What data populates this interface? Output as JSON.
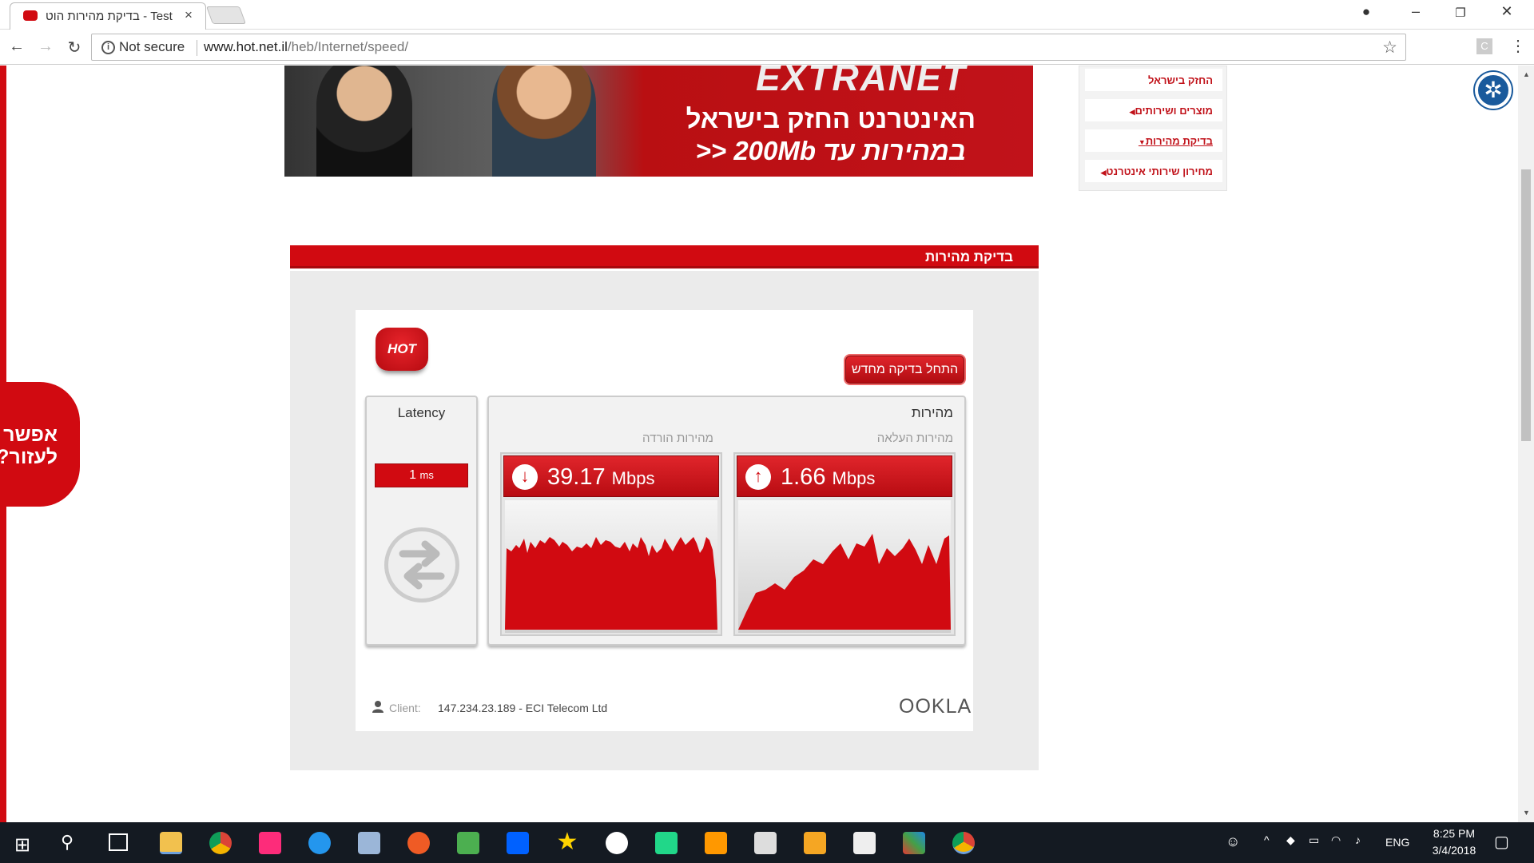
{
  "browser": {
    "tab_title": "בדיקת מהירות הוט - Test",
    "tab_close": "×",
    "not_secure": "Not secure",
    "url_host": "www.hot.net.il",
    "url_path": "/heb/Internet/speed/",
    "ext_letter": "C"
  },
  "banner": {
    "brand": "EXTRANET",
    "line1": "האינטרנט החזק בישראל",
    "line2": "במהירות עד 200Mb <<"
  },
  "sidebar": {
    "items": [
      {
        "label": "החזק בישראל"
      },
      {
        "label": "מוצרים ושירותים"
      },
      {
        "label": "בדיקת מהירות"
      },
      {
        "label": "מחירון שירותי אינטרנט"
      }
    ]
  },
  "help": {
    "label": "אפשר לעזור?"
  },
  "speedtest": {
    "section_title": "בדיקת מהירות",
    "logo": "HOT",
    "restart_label": "התחל בדיקה מחדש",
    "latency_label": "Latency",
    "latency_value": "1",
    "latency_unit": "ms",
    "speed_label": "מהירות",
    "download_label": "מהירות הורדה",
    "upload_label": "מהירות העלאה",
    "download_value": "39.17",
    "upload_value": "1.66",
    "unit": "Mbps",
    "client_label": "Client:",
    "client_value": "147.234.23.189 - ECI Telecom Ltd",
    "ookla": "OOKLA"
  },
  "taskbar": {
    "language": "ENG",
    "time": "8:25 PM",
    "date": "3/4/2018"
  },
  "colors": {
    "brand_red": "#d10a11",
    "taskbar": "#141a22"
  }
}
